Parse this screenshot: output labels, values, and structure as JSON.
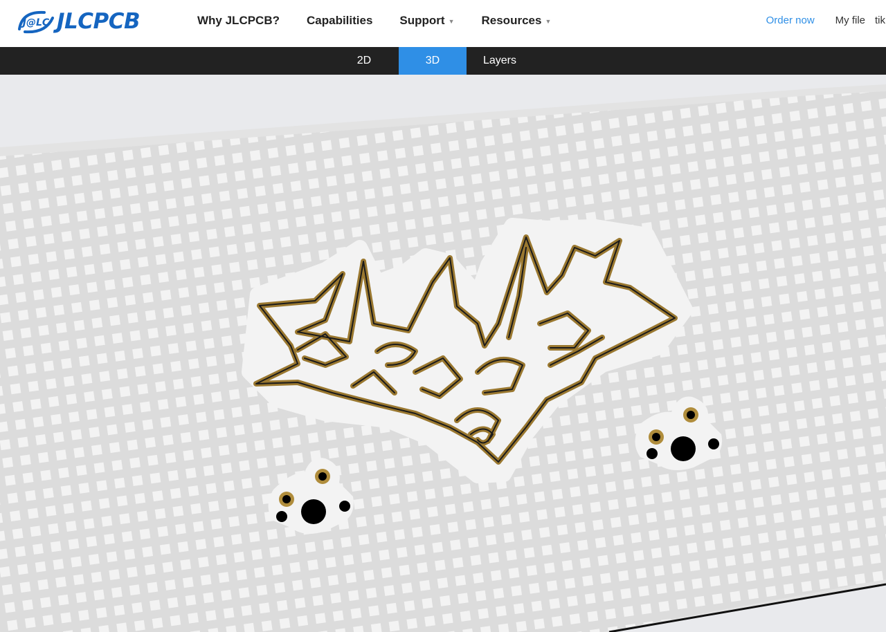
{
  "header": {
    "logo_text": "JLCPCB",
    "logo_badge": "J@LC",
    "nav": [
      {
        "label": "Why JLCPCB?",
        "has_dropdown": false
      },
      {
        "label": "Capabilities",
        "has_dropdown": false
      },
      {
        "label": "Support",
        "has_dropdown": true
      },
      {
        "label": "Resources",
        "has_dropdown": true
      }
    ],
    "order_label": "Order now",
    "myfile_label": "My file",
    "user_label": "tik"
  },
  "viewer": {
    "tabs": [
      {
        "label": "2D",
        "active": false
      },
      {
        "label": "3D",
        "active": true
      },
      {
        "label": "Layers",
        "active": false
      }
    ]
  },
  "colors": {
    "brand": "#1565c0",
    "accent": "#2f8fe6",
    "tabbar": "#222222",
    "board": "#e0e0e0",
    "copper": "#b08d3c",
    "background": "#e9eaed"
  }
}
